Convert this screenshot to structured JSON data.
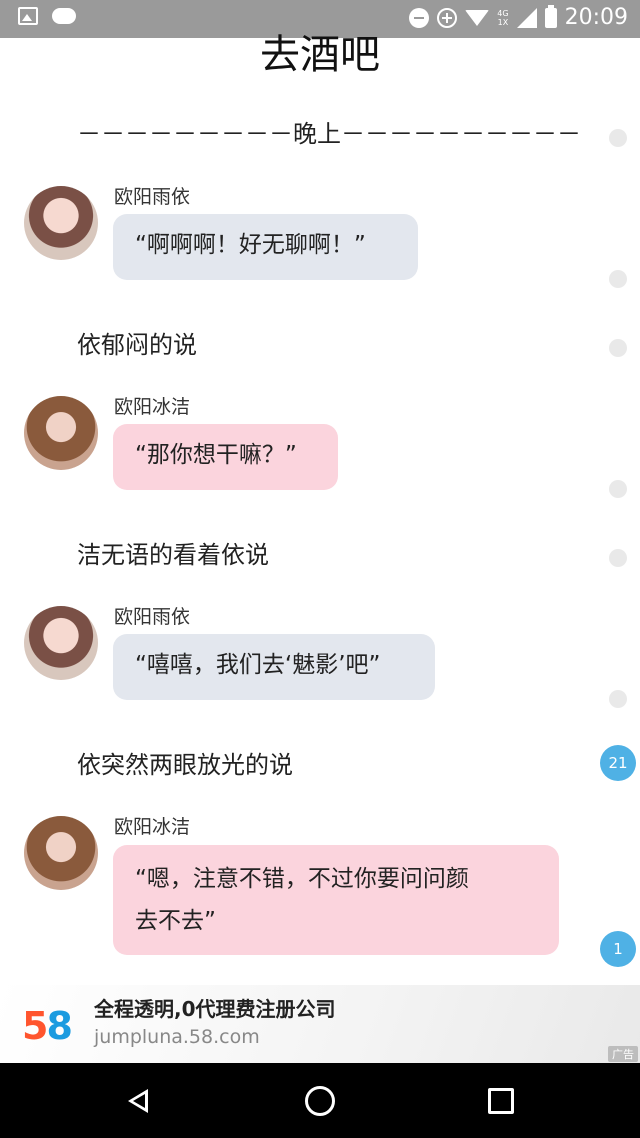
{
  "status_bar": {
    "time": "20:09",
    "network_label": "4G",
    "network_sub": "1X",
    "icons": [
      "image-icon",
      "cloud-alert-icon",
      "minus-circle-icon",
      "data-saver-icon",
      "wifi-icon",
      "signal-icon",
      "battery-icon"
    ]
  },
  "page": {
    "title": "去酒吧"
  },
  "story": {
    "divider": "－－－－－－－－－晚上－－－－－－－－－－",
    "messages": [
      {
        "speaker": "欧阳雨依",
        "text": "“啊啊啊！好无聊啊！”",
        "bubble_color": "#e3e7ee"
      },
      {
        "narration": "依郁闷的说"
      },
      {
        "speaker": "欧阳冰洁",
        "text": "“那你想干嘛？”",
        "bubble_color": "#fbd4dd"
      },
      {
        "narration": "洁无语的看着依说"
      },
      {
        "speaker": "欧阳雨依",
        "text": "“嘻嘻，我们去‘魅影’吧”",
        "bubble_color": "#e3e7ee"
      },
      {
        "narration": "依突然两眼放光的说"
      },
      {
        "speaker": "欧阳冰洁",
        "text_line1": "“嗯，注意不错，不过你要问问颜",
        "text_line2": "去不去”",
        "bubble_color": "#fbd4dd"
      }
    ],
    "comment_counts": [
      "21",
      "1"
    ]
  },
  "ad": {
    "logo_5": "5",
    "logo_8": "8",
    "title": "全程透明,0代理费注册公司",
    "url": "jumpluna.58.com",
    "tag": "广告"
  },
  "colors": {
    "accent_blue": "#4fb1e5",
    "bubble_blue": "#e3e7ee",
    "bubble_pink": "#fbd4dd",
    "status_bar": "#9a9a9a"
  }
}
